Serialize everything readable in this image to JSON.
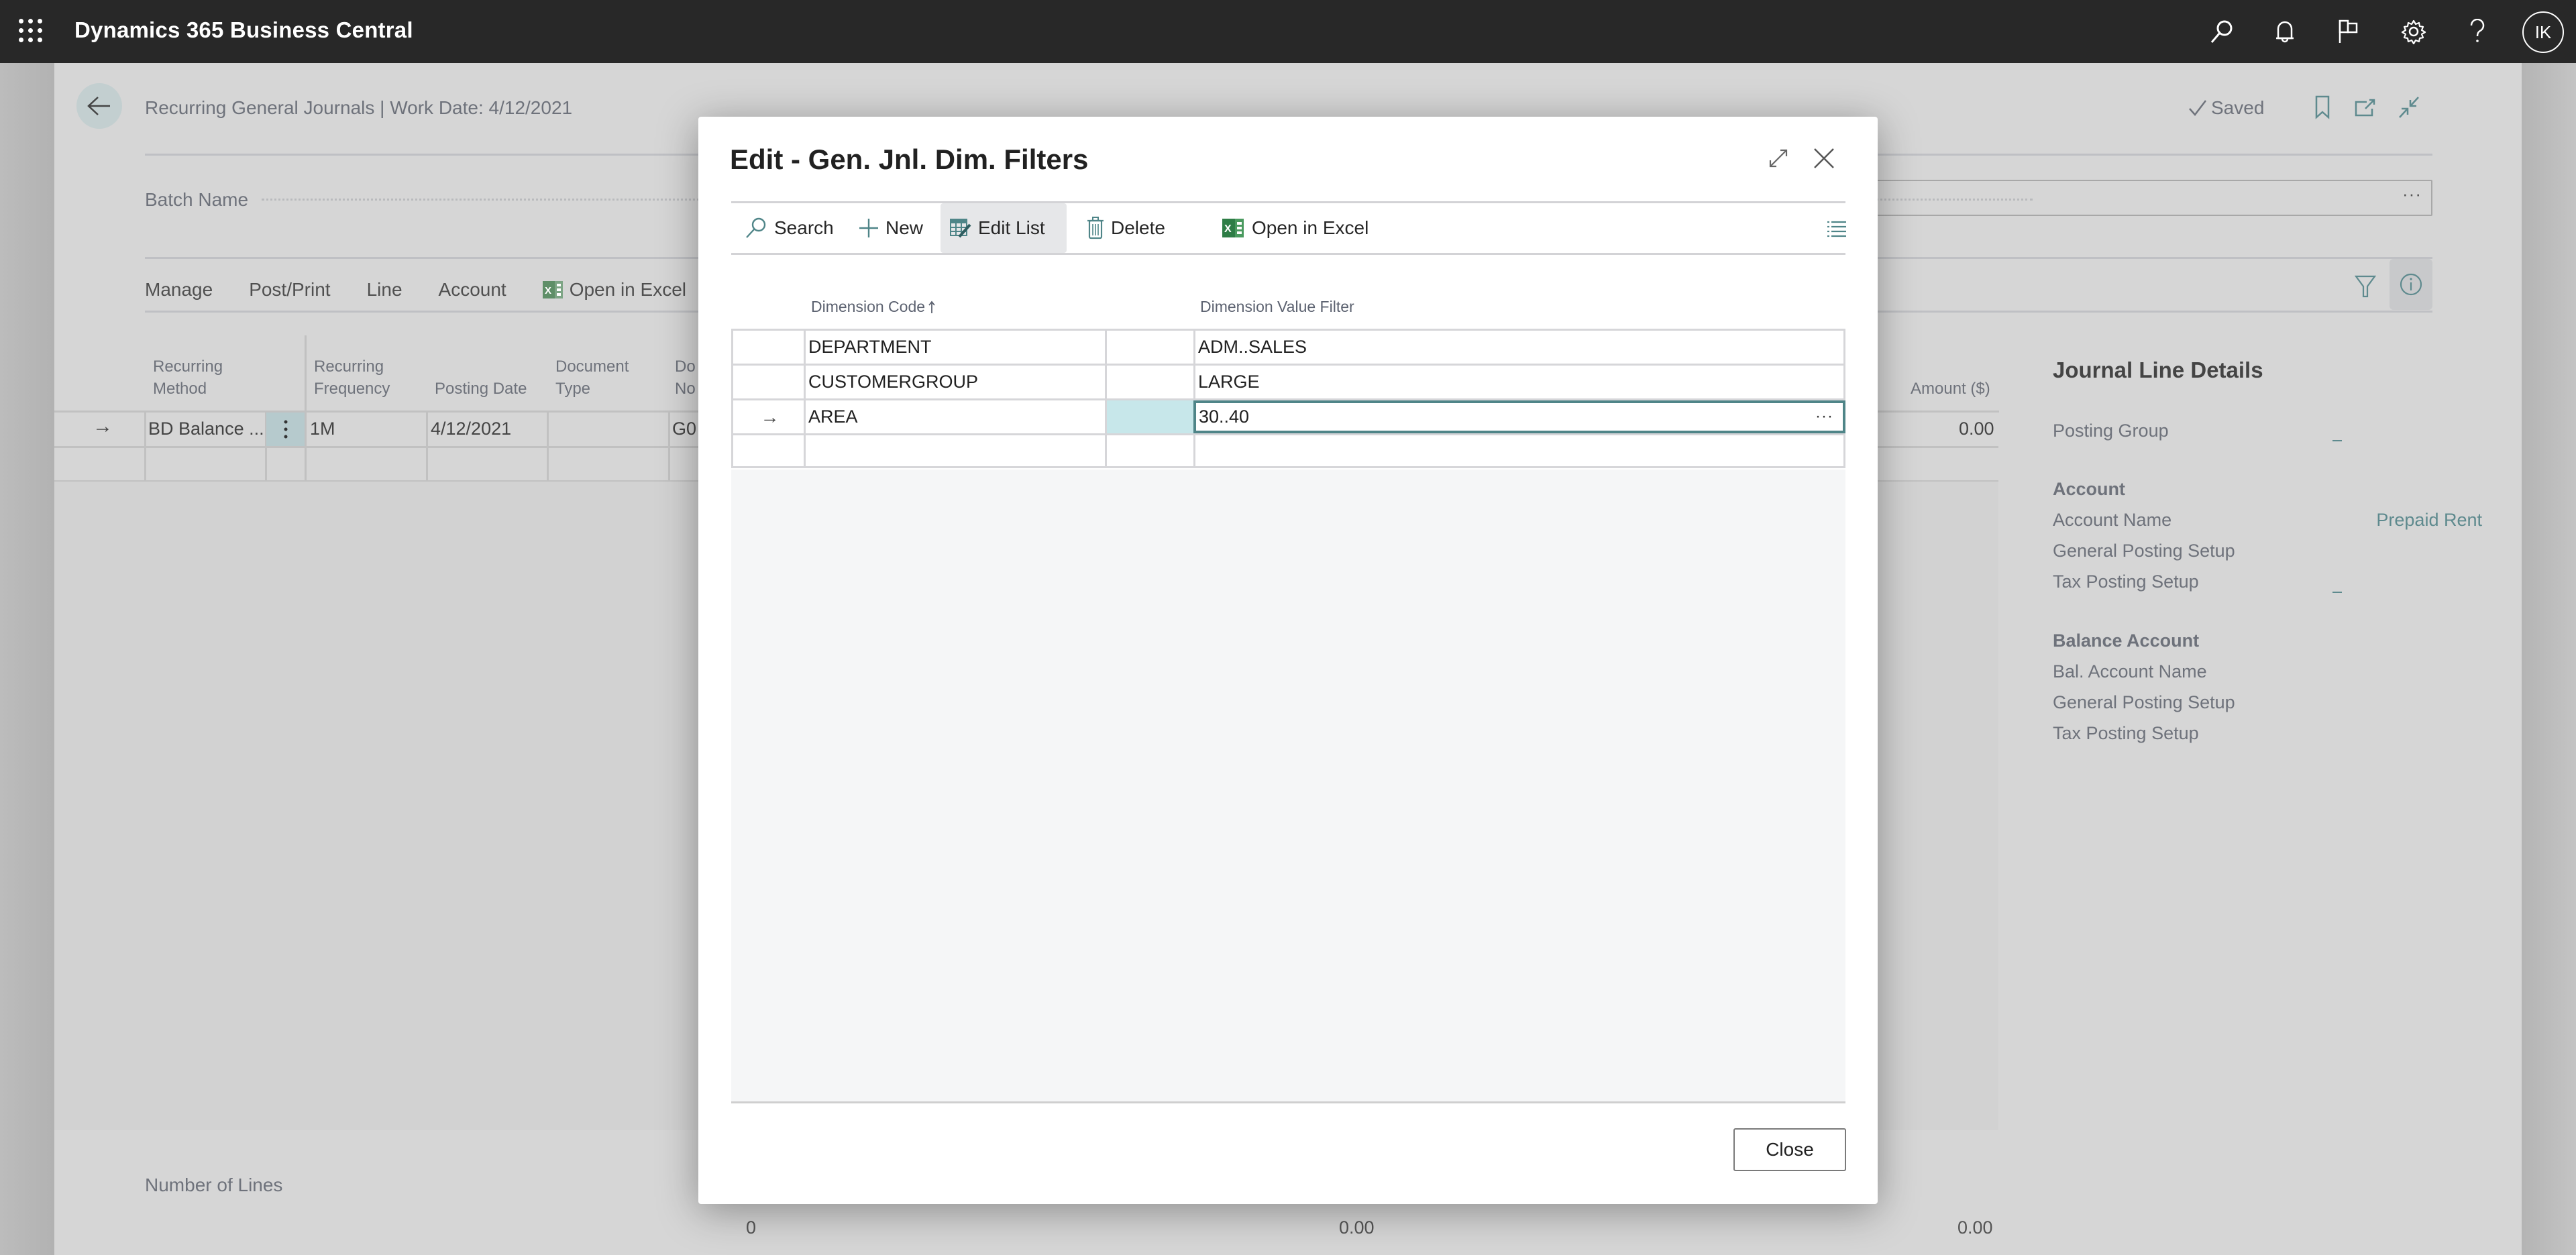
{
  "app": {
    "title": "Dynamics 365 Business Central",
    "avatar_initials": "IK",
    "icons": [
      "search-icon",
      "bell-icon",
      "flag-icon",
      "gear-icon",
      "help-icon"
    ]
  },
  "page": {
    "title": "Recurring General Journals | Work Date: 4/12/2021",
    "saved_label": "Saved",
    "batch_label": "Batch Name",
    "batch_value": "",
    "actions": [
      "Manage",
      "Post/Print",
      "Line",
      "Account",
      "Open in Excel"
    ],
    "grid": {
      "columns": [
        "Recurring Method",
        "Recurring Frequency",
        "Posting Date",
        "Document Type",
        "Do... No.",
        "Amount ($)"
      ],
      "col1_line1": "Recurring",
      "col1_line2": "Method",
      "col2_line1": "Recurring",
      "col2_line2": "Frequency",
      "col3": "Posting Date",
      "col4_line1": "Document",
      "col4_line2": "Type",
      "col5_line1": "Do",
      "col5_line2": "No",
      "amount_header": "Amount ($)",
      "row": {
        "recurring_method": "BD Balance ...",
        "recurring_frequency": "1M",
        "posting_date": "4/12/2021",
        "document_type": "",
        "document_no": "G0",
        "amount": "0.00"
      }
    },
    "footer": {
      "lines_label": "Number of Lines",
      "lines_value": "0",
      "total1": "0.00",
      "total2": "0.00"
    }
  },
  "factbox": {
    "title": "Journal Line Details",
    "posting_group_label": "Posting Group",
    "posting_group_value": "_",
    "account_heading": "Account",
    "account_name_label": "Account Name",
    "account_name_value": "Prepaid Rent",
    "gen_posting_setup_label": "General Posting Setup",
    "tax_posting_setup_label": "Tax Posting Setup",
    "tax_posting_setup_value": "_",
    "balance_heading": "Balance Account",
    "bal_account_name_label": "Bal. Account Name",
    "bal_gen_posting_setup_label": "General Posting Setup",
    "bal_tax_posting_setup_label": "Tax Posting Setup"
  },
  "dialog": {
    "title": "Edit - Gen. Jnl. Dim. Filters",
    "toolbar": {
      "search": "Search",
      "new": "New",
      "edit_list": "Edit List",
      "delete": "Delete",
      "open_in_excel": "Open in Excel"
    },
    "columns": {
      "dimension_code": "Dimension Code",
      "dimension_code_sort": "ascending",
      "dimension_value_filter": "Dimension Value Filter"
    },
    "rows": [
      {
        "dimension_code": "DEPARTMENT",
        "dimension_value_filter": "ADM..SALES",
        "current": false
      },
      {
        "dimension_code": "CUSTOMERGROUP",
        "dimension_value_filter": "LARGE",
        "current": false
      },
      {
        "dimension_code": "AREA",
        "dimension_value_filter": "30..40",
        "current": true
      },
      {
        "dimension_code": "",
        "dimension_value_filter": "",
        "current": false
      }
    ],
    "close_label": "Close"
  },
  "colors": {
    "accent": "#4f8588",
    "appbar": "#282828",
    "selected_cell": "#c7e7ea",
    "excel_green": "#2e7d46"
  }
}
